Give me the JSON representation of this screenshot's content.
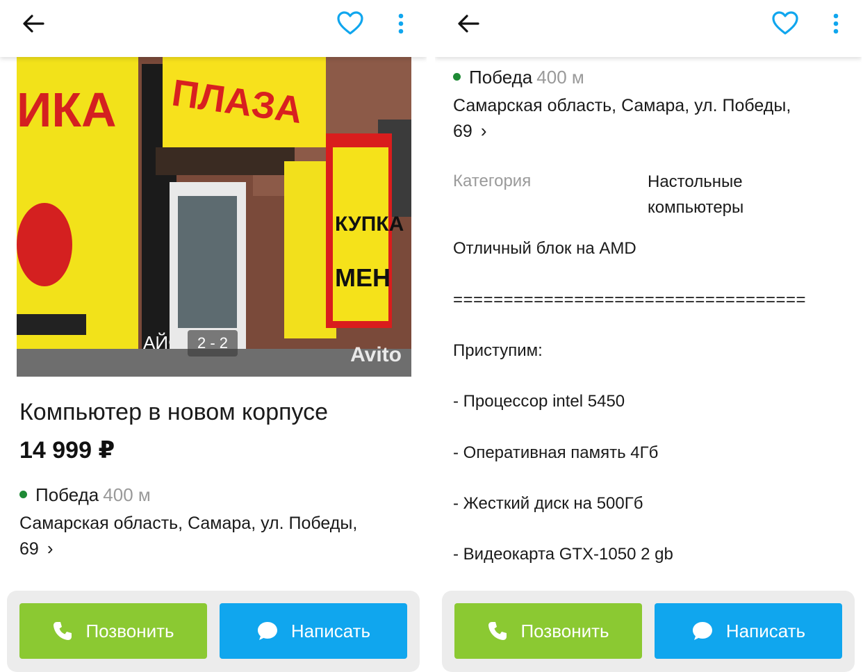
{
  "left": {
    "header": {
      "back_icon": "arrow-left-icon",
      "favorite_icon": "heart-icon",
      "more_icon": "kebab-menu-icon"
    },
    "photo": {
      "counter": "2 - 2",
      "sign_text": "ПЛАЗА",
      "watermark": "Avito"
    },
    "listing": {
      "title": "Компьютер в новом корпусе",
      "price": "14 999 ₽",
      "metro_station": "Победа",
      "metro_distance": "400 м",
      "address_line1": "Самарская область, Самара, ул. Победы,",
      "address_line2": "69"
    },
    "actions": {
      "call_label": "Позвонить",
      "message_label": "Написать"
    }
  },
  "right": {
    "header": {
      "back_icon": "arrow-left-icon",
      "favorite_icon": "heart-icon",
      "more_icon": "kebab-menu-icon"
    },
    "listing": {
      "metro_station": "Победа",
      "metro_distance": "400 м",
      "address_line1": "Самарская область, Самара, ул. Победы,",
      "address_line2": "69"
    },
    "params": {
      "category_label": "Категория",
      "category_value_line1": "Настольные",
      "category_value_line2": "компьютеры"
    },
    "description": [
      "Отличный блок на AMD",
      "===================================",
      "Приступим:",
      "- Процессор intel 5450",
      "- Оперативная память 4Гб",
      "- Жесткий диск на 500Гб",
      "- Видеокарта GTX-1050 2 gb"
    ],
    "actions": {
      "call_label": "Позвонить",
      "message_label": "Написать"
    }
  },
  "colors": {
    "accent_blue": "#10a6ee",
    "call_green": "#8bc932",
    "metro_green": "#1e8a35",
    "muted": "#9a9a9a"
  }
}
